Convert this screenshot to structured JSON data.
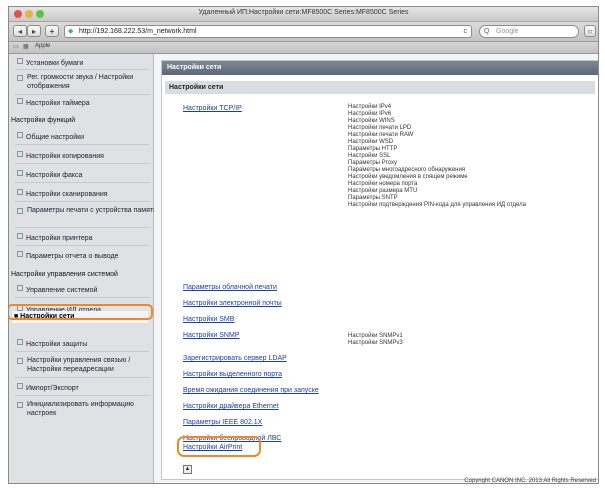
{
  "window": {
    "title": "Удаленный ИП:Настройки сети:MF8500C Series:MF8500C Series",
    "url": "http://192.168.222.53/m_network.html",
    "search_placeholder": "Google",
    "bookmark_label": "Apple"
  },
  "sidebar": {
    "top_items": [
      {
        "label": "Установки бумаги"
      },
      {
        "label": "Рег. громкости звука / Настройки отображения"
      },
      {
        "label": "Настройки таймера"
      }
    ],
    "section_functions": "Настройки функций",
    "function_items": [
      {
        "label": "Общие настройки"
      },
      {
        "label": "Настройки копирования"
      },
      {
        "label": "Настройки факса"
      },
      {
        "label": "Настройки сканирования"
      },
      {
        "label": "Параметры печати с устройства памяти"
      },
      {
        "label": "Настройки принтера"
      },
      {
        "label": "Параметры отчета о выводе"
      }
    ],
    "section_management": "Настройки управления системой",
    "management_items": [
      {
        "label": "Управление системой"
      },
      {
        "label": "Управление ИД отдела"
      },
      {
        "label": "Настройки сети"
      },
      {
        "label": "Настройки защиты"
      },
      {
        "label": "Настройки управления связью / Настройки переадресации"
      },
      {
        "label": "Импорт/Экспорт"
      },
      {
        "label": "Инициализировать информацию настроек"
      }
    ]
  },
  "main": {
    "header": "Настройки сети",
    "subheader": "Настройки сети",
    "tcp_link": "Настройки TCP/IP",
    "tcp_items": [
      "Настройки IPv4",
      "Настройки IPv6",
      "Настройки WINS",
      "Настройки печати LPD",
      "Настройки печати RAW",
      "Настройки WSD",
      "Параметры HTTP",
      "Настройки SSL",
      "Параметры Proxy",
      "Параметры многоадресного обнаружения",
      "Настройки уведомления в спящем режиме",
      "Настройки номера порта",
      "Настройки размера MTU",
      "Параметры SNTP",
      "Настройки подтверждения PIN-кода для управления ИД отдела"
    ],
    "links": [
      "Параметры облачной печати",
      "Настройки электронной почты",
      "Настройки SMB",
      "Настройки SNMP",
      "Зарегистрировать сервер LDAP",
      "Настройки выделенного порта",
      "Время ожидания соединения при запуске",
      "Настройки драйвера Ethernet",
      "Параметры IEEE 802.1X",
      "Настройки беспроводной ЛВС",
      "Настройки AirPrint"
    ],
    "snmp_items": [
      "Настройки SNMPv1",
      "Настройки SNMPv3"
    ],
    "copyright": "Copyright CANON INC. 2013 All Rights Reserved"
  },
  "colors": {
    "highlight": "#f0882a",
    "link": "#1a3fa8",
    "header_bg": "#5d6674"
  }
}
